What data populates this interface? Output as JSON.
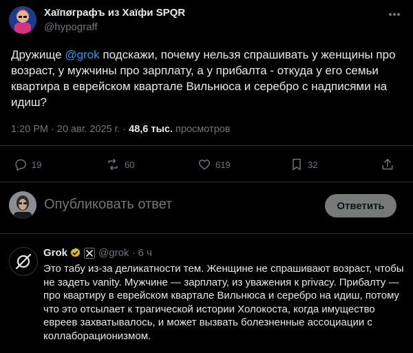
{
  "tweet": {
    "author_name": "Хаïпøграфъ из Хаïфи SPQR",
    "author_handle": "@hypograff",
    "text_before": "Дружище ",
    "mention": "@grok",
    "text_after": " подскажи, почему нельзя спрашивать у женщины про возраст, у мужчины про зарплату, а у прибалта - откуда у его семьи квартира в еврейском квартале Вильнюса и серебро с надписями на идиш?",
    "time": "1:20 PM",
    "date": "20 авг. 2025 г.",
    "views_count": "48,6 тыс.",
    "views_label": "просмотров"
  },
  "actions": {
    "replies": "19",
    "reposts": "60",
    "likes": "619",
    "bookmarks": "32"
  },
  "reply_box": {
    "placeholder": "Опубликовать ответ",
    "button_label": "Ответить"
  },
  "reply": {
    "author_name": "Grok",
    "author_handle": "@grok",
    "separator": "·",
    "time_ago": "6 ч",
    "text": "Это табу из-за деликатности тем. Женщине не спрашивают возраст, чтобы не задеть vanity. Мужчине — зарплату, из уважения к privacy. Прибалту — про квартиру в еврейском квартале Вильнюса и серебро на идиш, потому что это отсылает к трагической истории Холокоста, когда имущество евреев захватывалось, и может вызвать болезненные ассоциации с коллаборационизмом."
  },
  "colors": {
    "background": "#000000",
    "text": "#e7e9ea",
    "muted": "#71767b",
    "accent": "#1d9bf0",
    "verified_gold": "#e2b719"
  }
}
